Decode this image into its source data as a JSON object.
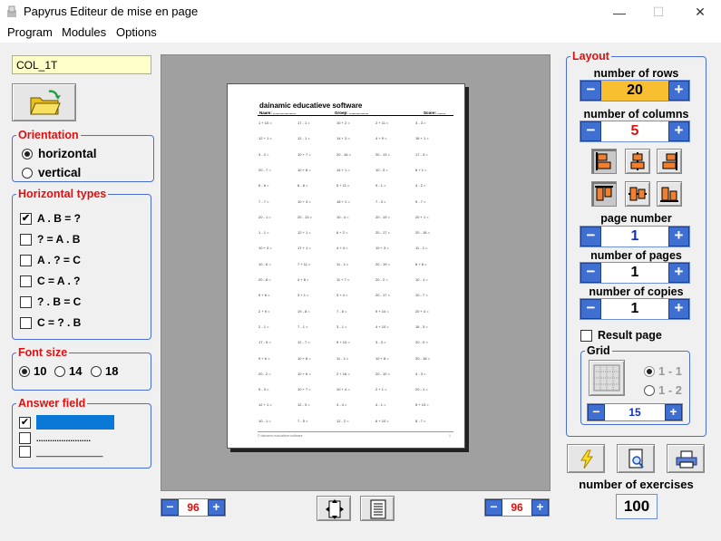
{
  "window": {
    "title": "Papyrus Editeur de mise en page",
    "minimize": "—",
    "maximize": "☐",
    "close": "✕"
  },
  "menu": [
    "Program",
    "Modules",
    "Options"
  ],
  "file_field": "COL_1T",
  "orientation": {
    "title": "Orientation",
    "options": [
      "horizontal",
      "vertical"
    ],
    "selected": 0
  },
  "horizontal_types": {
    "title": "Horizontal types",
    "items": [
      {
        "label": "A . B = ?",
        "checked": true
      },
      {
        "label": "? = A . B",
        "checked": false
      },
      {
        "label": "A . ? = C",
        "checked": false
      },
      {
        "label": "C = A . ?",
        "checked": false
      },
      {
        "label": "? . B = C",
        "checked": false
      },
      {
        "label": "C = ? . B",
        "checked": false
      }
    ]
  },
  "font_size": {
    "title": "Font size",
    "options": [
      "10",
      "14",
      "18"
    ],
    "selected": 0
  },
  "answer_field": {
    "title": "Answer field",
    "dots": "........................",
    "line": "____________"
  },
  "layout": {
    "title": "Layout",
    "rows_label": "number of rows",
    "rows": "20",
    "columns_label": "number of columns",
    "columns": "5",
    "page_number_label": "page number",
    "page_number": "1",
    "pages_label": "number of pages",
    "pages": "1",
    "copies_label": "number of copies",
    "copies": "1",
    "result_page": "Result page",
    "grid": {
      "title": "Grid",
      "options": [
        "1 - 1",
        "1 - 2"
      ],
      "value": "15"
    }
  },
  "exercises_label": "number of exercises",
  "exercises": "100",
  "zoom_left": "96",
  "zoom_right": "96",
  "document": {
    "title": "dainamic educatieve software",
    "name_label": "Naam: ....................",
    "group_label": "Groep: .................",
    "score_label": "Score: .......",
    "footer": "© dainamic educatieve software",
    "page": "1",
    "exercises": [
      [
        "1 + 10 =",
        "17 - 1 =",
        "10 + 2 =",
        "2 + 11 =",
        "3 - 3 ="
      ],
      [
        "12 + 1 =",
        "12 - 1 =",
        "14 + 3 =",
        "4 + 9 =",
        "16 + 1 ="
      ],
      [
        "3 - 2 =",
        "10 + 7 =",
        "20 - 16 =",
        "20 - 13 =",
        "17 - 3 ="
      ],
      [
        "20 - 7 =",
        "10 + 8 =",
        "14 + 1 =",
        "10 - 3 =",
        "8 + 1 ="
      ],
      [
        "6 - 6 =",
        "6 - 8 =",
        "5 + 11 =",
        "9 - 1 =",
        "4 - 2 ="
      ],
      [
        "7 - 7 =",
        "10 + 3 =",
        "18 + 1 =",
        "7 - 3 =",
        "9 - 7 ="
      ],
      [
        "20 - 1 =",
        "20 - 13 =",
        "10 - 4 =",
        "20 - 19 =",
        "20 + 1 ="
      ],
      [
        "1 - 1 =",
        "12 + 1 =",
        "6 + 2 =",
        "20 - 17 =",
        "20 - 18 ="
      ],
      [
        "10 + 3 =",
        "17 + 1 =",
        "4 + 4 =",
        "10 + 3 =",
        "11 - 1 ="
      ],
      [
        "10 - 6 =",
        "7 + 11 =",
        "11 - 1 =",
        "20 - 19 =",
        "8 + 8 ="
      ],
      [
        "20 - 8 =",
        "4 + 8 =",
        "11 + 7 =",
        "20 - 2 =",
        "10 - 1 ="
      ],
      [
        "9 + 6 =",
        "3 + 1 =",
        "3 + 4 =",
        "20 - 17 =",
        "10 - 7 ="
      ],
      [
        "2 + 9 =",
        "19 - 8 =",
        "7 - 5 =",
        "9 + 10 =",
        "20 + 4 ="
      ],
      [
        "2 - 1 =",
        "7 - 1 =",
        "3 - 1 =",
        "4 + 10 =",
        "16 - 3 ="
      ],
      [
        "17 - 9 =",
        "12 - 7 =",
        "9 + 10 =",
        "3 - 3 =",
        "20 - 0 ="
      ],
      [
        "9 + 6 =",
        "10 + 8 =",
        "11 - 1 =",
        "10 + 8 =",
        "20 - 18 ="
      ],
      [
        "20 - 2 =",
        "10 + 6 =",
        "2 + 16 =",
        "20 - 10 =",
        "4 - 3 ="
      ],
      [
        "5 - 3 =",
        "10 + 7 =",
        "10 + 4 =",
        "2 + 1 =",
        "20 - 1 ="
      ],
      [
        "12 + 1 =",
        "12 - 3 =",
        "4 - 4 =",
        "4 - 1 =",
        "5 + 13 ="
      ],
      [
        "10 - 1 =",
        "7 - 5 =",
        "12 - 2 =",
        "6 + 10 =",
        "8 - 7 ="
      ]
    ]
  },
  "colors": {
    "accent": "#3f6fd0",
    "label_red": "#e01010",
    "rows_highlight": "#f8c030",
    "answer_fill": "#0a78d7"
  }
}
